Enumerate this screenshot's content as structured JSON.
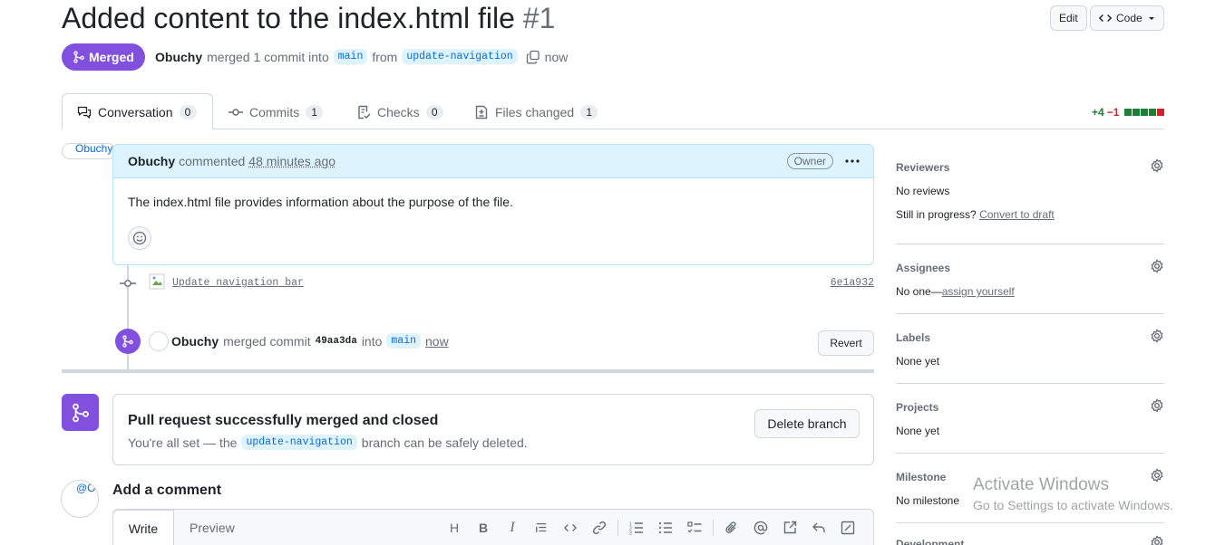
{
  "header": {
    "title": "Added content to the index.html file",
    "number": "#1",
    "edit_label": "Edit",
    "code_label": "Code",
    "state_label": "Merged",
    "author": "Obuchy",
    "merged_text": "merged 1 commit into",
    "base_branch": "main",
    "from_text": "from",
    "head_branch": "update-navigation",
    "time": "now"
  },
  "tabs": [
    {
      "label": "Conversation",
      "count": "0",
      "icon": "comment-discussion-icon"
    },
    {
      "label": "Commits",
      "count": "1",
      "icon": "git-commit-icon"
    },
    {
      "label": "Checks",
      "count": "0",
      "icon": "checklist-icon"
    },
    {
      "label": "Files changed",
      "count": "1",
      "icon": "file-diff-icon"
    }
  ],
  "diffstat": {
    "additions": "+4",
    "deletions": "−1",
    "colors": [
      "#1a7f37",
      "#1a7f37",
      "#1a7f37",
      "#1a7f37",
      "#cf222e"
    ]
  },
  "comment": {
    "avatar_alt": "Obuchy",
    "author": "Obuchy",
    "action": "commented",
    "time": "48 minutes ago",
    "role": "Owner",
    "body": "The index.html file provides information about the purpose of the file."
  },
  "timeline": {
    "commit_message": "Update navigation bar",
    "commit_sha": "6e1a932",
    "merge_author": "Obuchy",
    "merge_text": "merged commit",
    "merge_sha": "49aa3da",
    "into_text": "into",
    "merge_branch": "main",
    "merge_time": "now",
    "revert_label": "Revert"
  },
  "merged_box": {
    "title": "Pull request successfully merged and closed",
    "sub_prefix": "You're all set — the",
    "branch": "update-navigation",
    "sub_suffix": "branch can be safely deleted.",
    "delete_label": "Delete branch"
  },
  "add_comment": {
    "avatar_alt": "@Obuchy",
    "title": "Add a comment",
    "write_tab": "Write",
    "preview_tab": "Preview",
    "toolbar": [
      "heading-icon",
      "bold-icon",
      "italic-icon",
      "quote-icon",
      "code-icon",
      "link-icon",
      "ordered-list-icon",
      "unordered-list-icon",
      "task-list-icon",
      "attach-icon",
      "mention-icon",
      "cross-reference-icon",
      "reply-icon",
      "fullscreen-icon"
    ]
  },
  "sidebar": {
    "reviewers": {
      "heading": "Reviewers",
      "text": "No reviews",
      "progress": "Still in progress?",
      "progress_link": "Convert to draft"
    },
    "assignees": {
      "heading": "Assignees",
      "text": "No one—",
      "link": "assign yourself"
    },
    "labels": {
      "heading": "Labels",
      "text": "None yet"
    },
    "projects": {
      "heading": "Projects",
      "text": "None yet"
    },
    "milestone": {
      "heading": "Milestone",
      "text": "No milestone"
    },
    "development": {
      "heading": "Development"
    }
  },
  "watermark": {
    "line1": "Activate Windows",
    "line2": "Go to Settings to activate Windows."
  }
}
